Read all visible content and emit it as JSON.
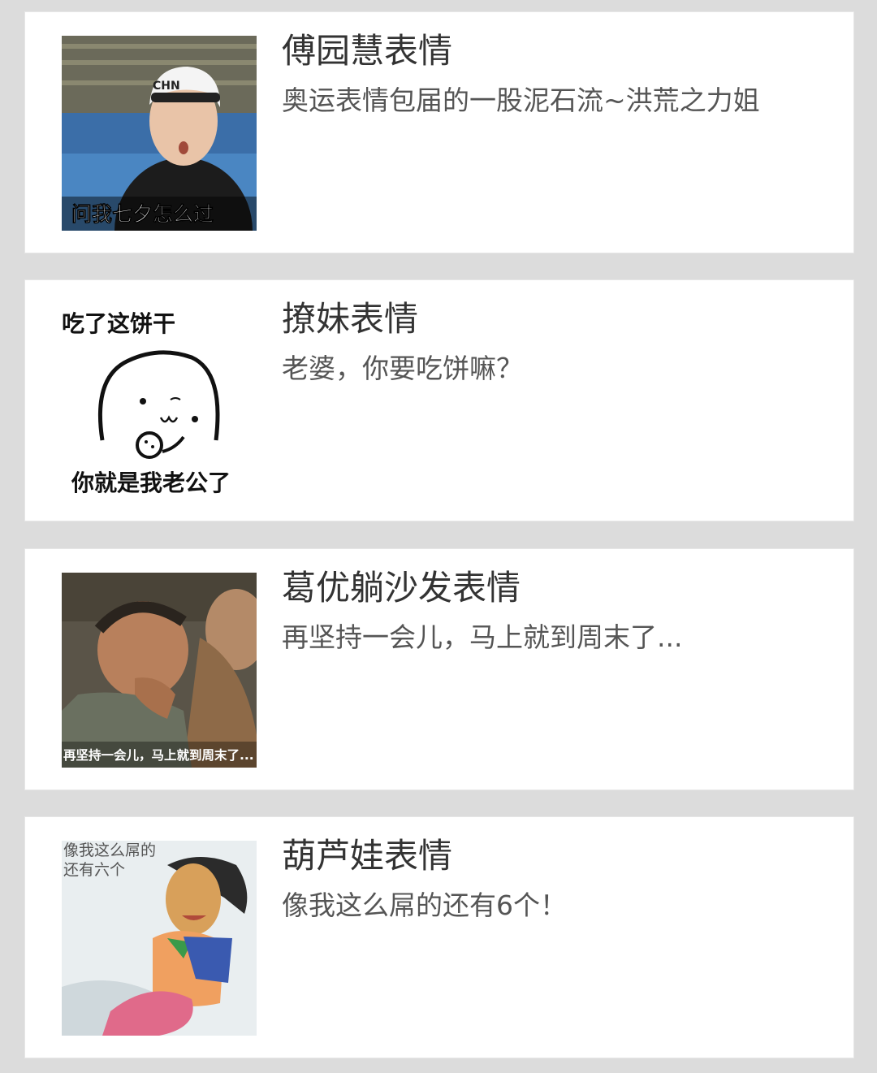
{
  "items": [
    {
      "title": "傅园慧表情",
      "desc": "奥运表情包届的一股泥石流~洪荒之力姐",
      "image_caption": "问我七夕怎么过",
      "cap_text": "CHN"
    },
    {
      "title": "撩妹表情",
      "desc": "老婆，你要吃饼嘛？",
      "image_caption_top": "吃了这饼干",
      "image_caption_bottom": "你就是我老公了"
    },
    {
      "title": "葛优躺沙发表情",
      "desc": "再坚持一会儿，马上就到周末了...",
      "image_caption": "再坚持一会儿，马上就到周末了..."
    },
    {
      "title": "葫芦娃表情",
      "desc": "像我这么屌的还有6个！",
      "image_caption_line1": "像我这么屌的",
      "image_caption_line2": "还有六个"
    }
  ]
}
